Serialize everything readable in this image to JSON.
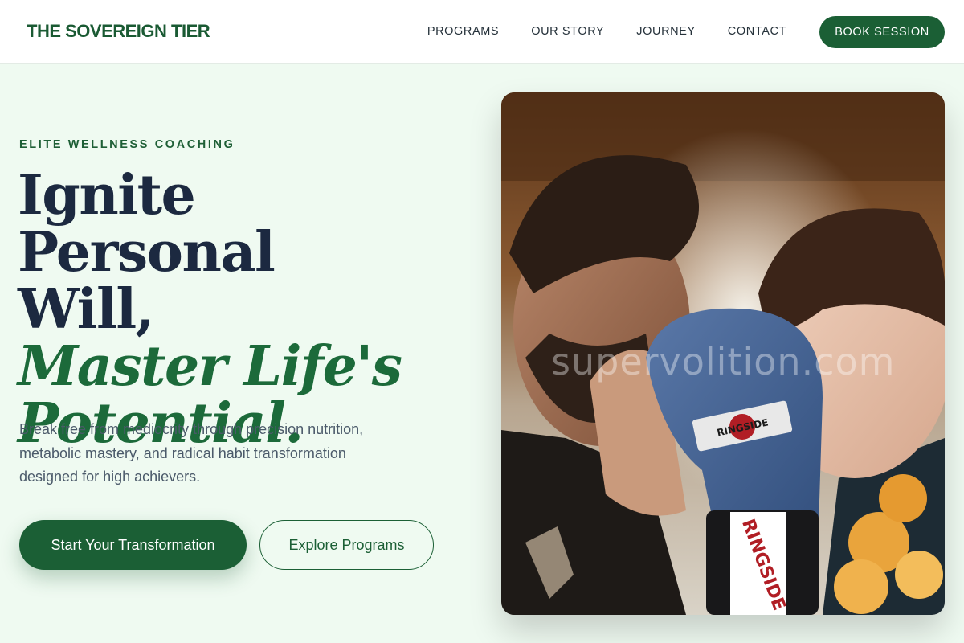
{
  "brand": {
    "name": "THE SOVEREIGN TIER"
  },
  "nav": {
    "items": [
      {
        "label": "PROGRAMS"
      },
      {
        "label": "OUR STORY"
      },
      {
        "label": "JOURNEY"
      },
      {
        "label": "CONTACT"
      }
    ],
    "cta_label": "BOOK SESSION"
  },
  "hero": {
    "eyebrow": "ELITE WELLNESS COACHING",
    "headline_line1": "Ignite Personal",
    "headline_line2": "Will,",
    "headline_accent1": "Master Life's",
    "headline_accent2": "Potential.",
    "subtext": "Break free from mediocrity through precision nutrition, metabolic mastery, and radical habit transformation designed for high achievers.",
    "primary_cta": "Start Your Transformation",
    "secondary_cta": "Explore Programs"
  },
  "photo": {
    "watermark": "supervolition.com",
    "glove_brand_top": "RINGSIDE",
    "glove_brand_cuff": "RINGSIDE"
  },
  "colors": {
    "brand_green": "#1b5f35",
    "accent_green": "#1c6a3a",
    "navy": "#1c2940",
    "background": "#effaf1"
  }
}
